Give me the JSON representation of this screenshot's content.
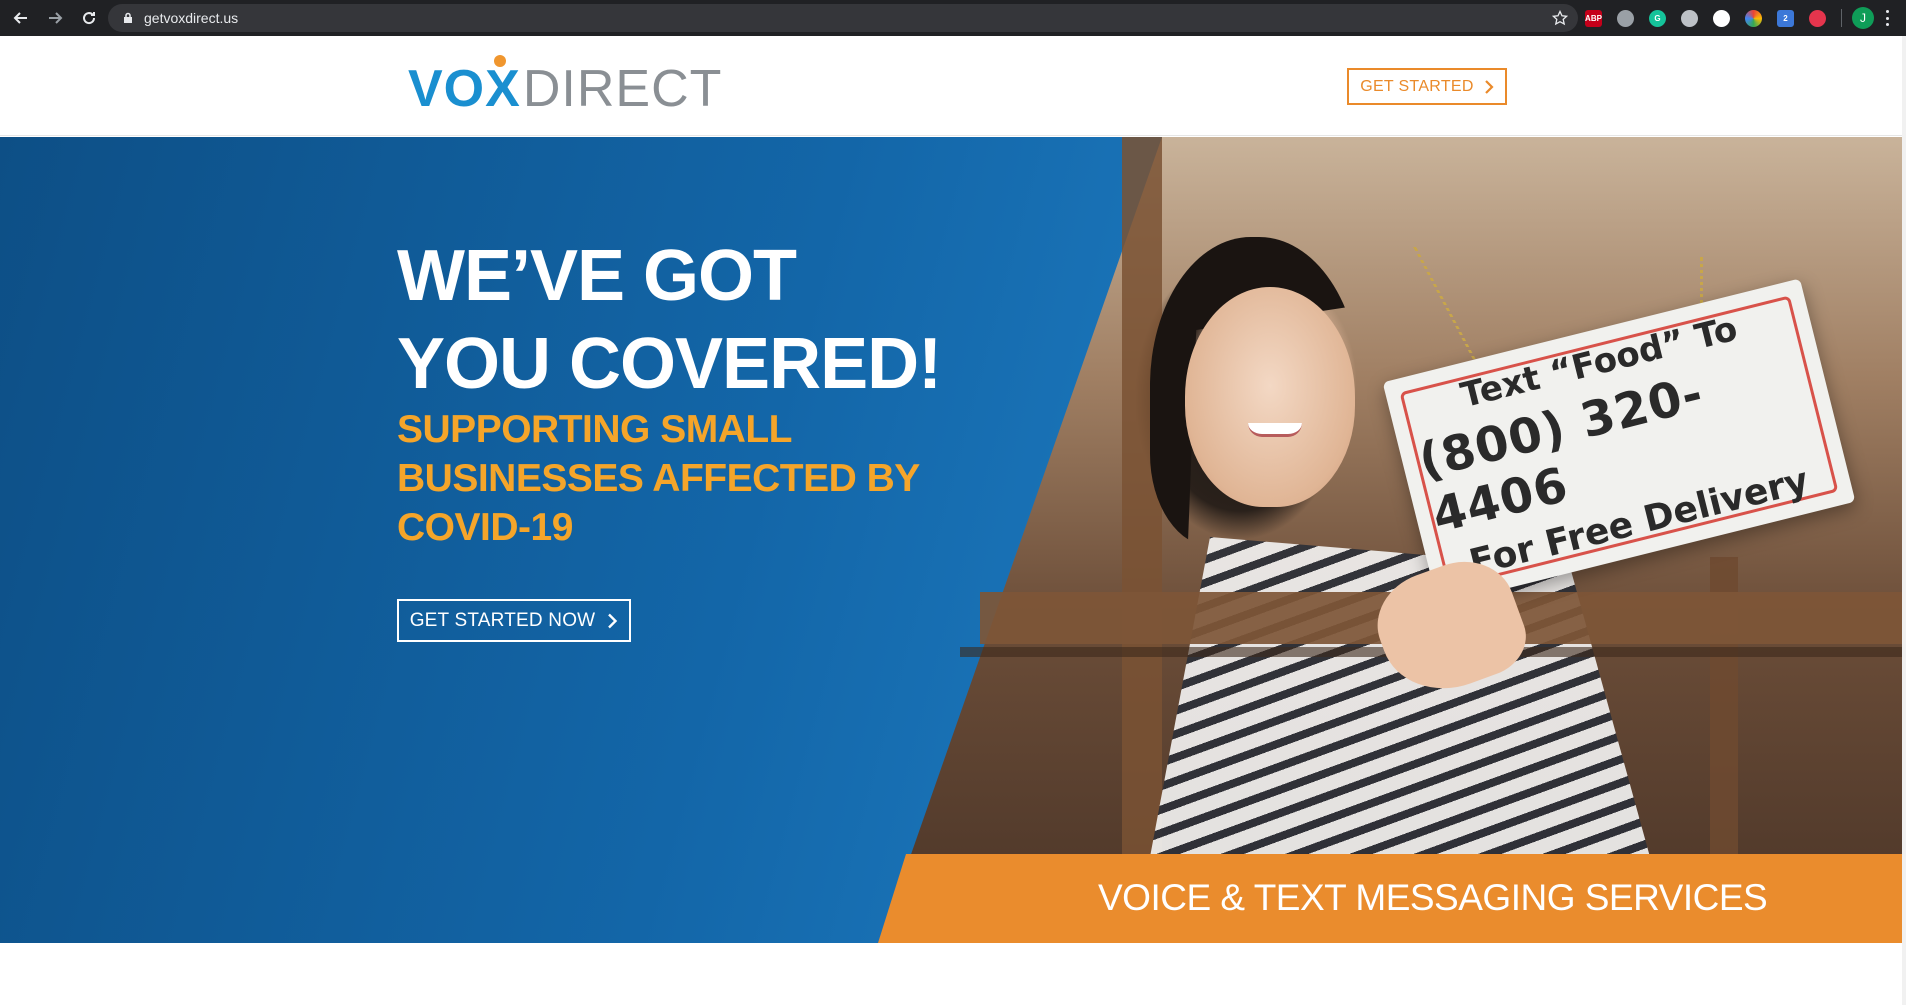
{
  "browser": {
    "url": "getvoxdirect.us",
    "profile_initial": "J",
    "extensions": [
      {
        "name": "adblock-plus-icon",
        "label": "ABP",
        "color": "#c5001a"
      },
      {
        "name": "camera-icon",
        "label": "",
        "color": "#9aa0a6"
      },
      {
        "name": "grammarly-icon",
        "label": "G",
        "color": "#15c39a"
      },
      {
        "name": "edit-extension-icon",
        "label": "",
        "color": "#e8eaed"
      },
      {
        "name": "pen-extension-icon",
        "label": "",
        "color": "#ffffff"
      },
      {
        "name": "color-picker-icon",
        "label": "",
        "color": "#f4b400"
      },
      {
        "name": "code-extension-icon",
        "label": "2",
        "color": "#3c78d8"
      },
      {
        "name": "link-extension-icon",
        "label": "",
        "color": "#e5354d"
      }
    ]
  },
  "header": {
    "logo_vox": "VOX",
    "logo_direct": "DIRECT",
    "cta_label": "GET STARTED"
  },
  "hero": {
    "title_line1": "WE’VE GOT",
    "title_line2": "YOU COVERED!",
    "subtitle_line1": "SUPPORTING SMALL",
    "subtitle_line2": "BUSINESSES AFFECTED BY",
    "subtitle_line3": "COVID-19",
    "cta_label": "GET STARTED NOW",
    "band_text": "VOICE & TEXT MESSAGING SERVICES",
    "sign": {
      "line1": "Text “Food” To",
      "line2": "(800) 320-4406",
      "line3": "For Free Delivery"
    }
  },
  "colors": {
    "brand_blue": "#1a8fd0",
    "brand_orange": "#ea8a2a",
    "subtitle_orange": "#f5a52a",
    "hero_blue": "#1366a8"
  }
}
